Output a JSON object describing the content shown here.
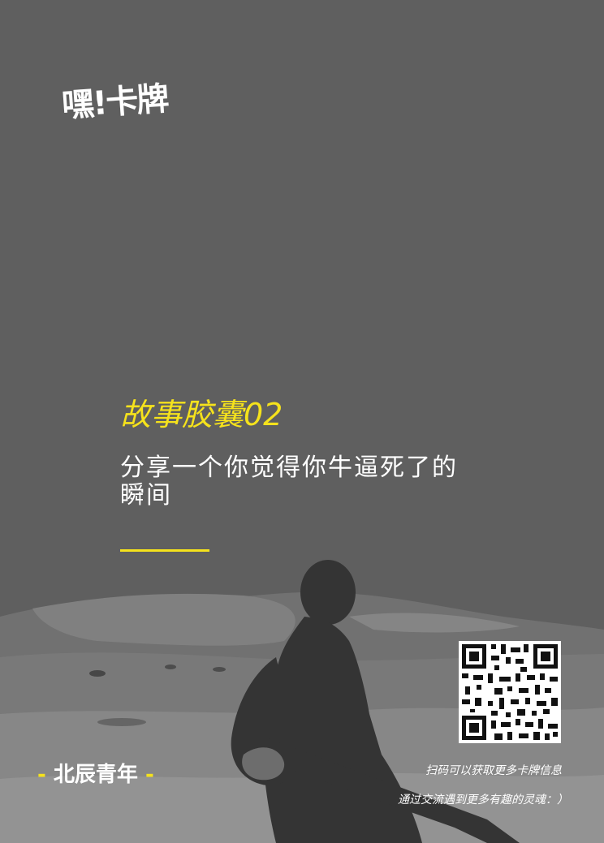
{
  "logo": {
    "text": "嘿!卡牌"
  },
  "card": {
    "title": "故事胶囊02",
    "prompt": "分享一个你觉得你牛逼死了的瞬间"
  },
  "brand": {
    "dash_left": "-",
    "name": "北辰青年",
    "dash_right": "-"
  },
  "footer": {
    "scan_text": "扫码可以获取更多卡牌信息",
    "discover_text": "通过交流遇到更多有趣的灵魂：）"
  },
  "colors": {
    "background": "#5f5f5f",
    "accent": "#f5e21c",
    "text": "#ffffff"
  },
  "icons": {
    "qr": "qr-code-icon",
    "figure": "guitarist-silhouette"
  }
}
